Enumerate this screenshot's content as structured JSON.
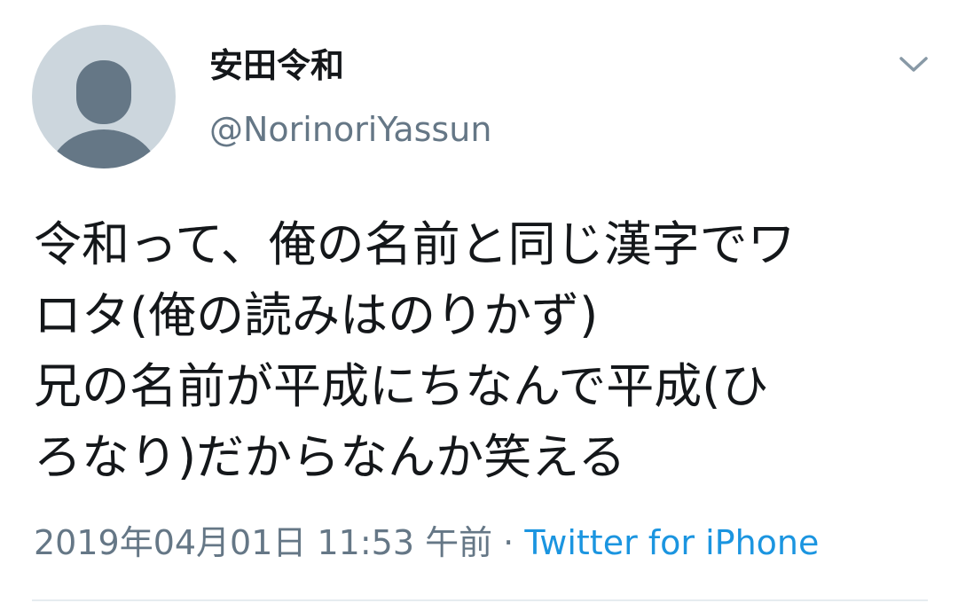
{
  "user": {
    "display_name": "安田令和",
    "handle": "@NorinoriYassun"
  },
  "tweet": {
    "lines": [
      "令和って、俺の名前と同じ漢字でワ",
      "ロタ(俺の読みはのりかず)",
      "兄の名前が平成にちなんで平成(ひ",
      "ろなり)だからなんか笑える"
    ]
  },
  "meta": {
    "timestamp": "2019年04月01日 11:53 午前",
    "separator": " · ",
    "source": "Twitter for iPhone"
  },
  "icons": {
    "avatar": "default-avatar-icon",
    "menu": "chevron-down-icon"
  },
  "colors": {
    "text": "#14171a",
    "secondary": "#657786",
    "link": "#1b95e0",
    "avatar_bg": "#ccd6dd",
    "avatar_fg": "#657786"
  }
}
